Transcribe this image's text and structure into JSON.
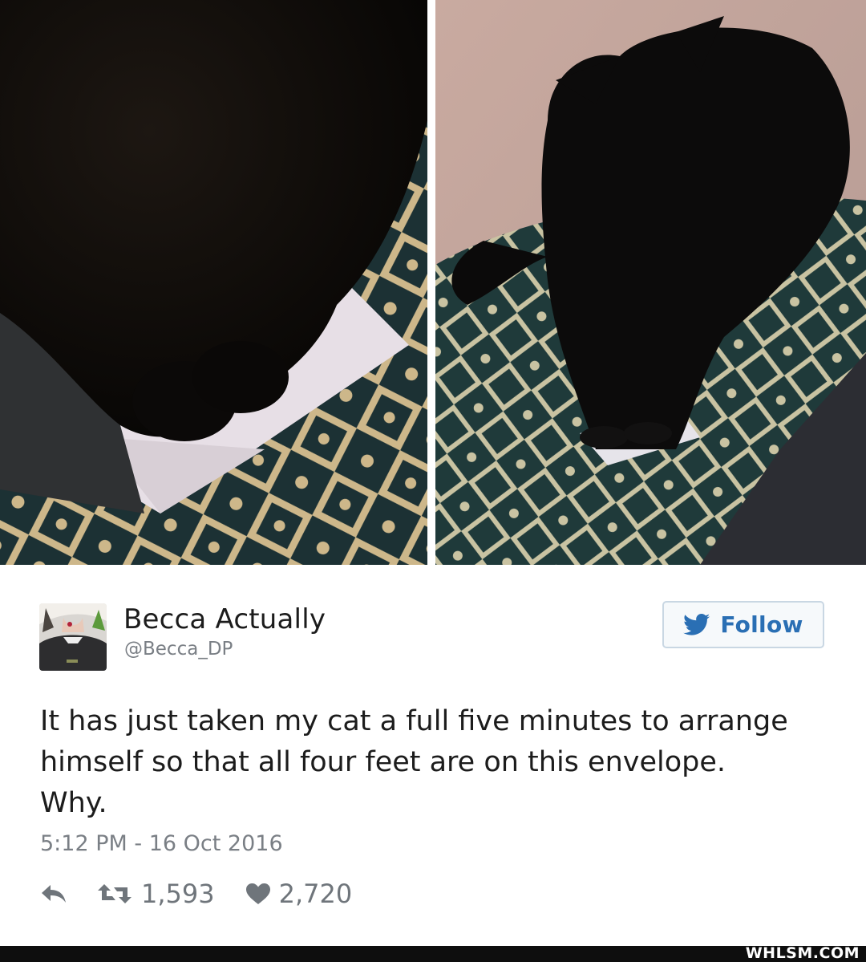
{
  "photos": {
    "left": {
      "icon": "cat-photo-closeup"
    },
    "right": {
      "icon": "cat-photo-sitting"
    }
  },
  "tweet": {
    "author": {
      "display_name": "Becca Actually",
      "handle": "@Becca_DP",
      "avatar_icon": "user-avatar"
    },
    "follow_button": {
      "label": "Follow",
      "icon": "twitter-bird-icon",
      "color": "#2a6fb4"
    },
    "text": "It has just taken my cat a full five minutes to arrange himself so that all four feet are on this envelope. Why.",
    "timestamp": "5:12 PM - 16 Oct 2016",
    "actions": {
      "reply": {
        "icon": "reply-icon"
      },
      "retweet": {
        "icon": "retweet-icon",
        "count": "1,593"
      },
      "like": {
        "icon": "heart-icon",
        "count": "2,720"
      }
    }
  },
  "footer": {
    "watermark": "WHLSM.COM"
  }
}
